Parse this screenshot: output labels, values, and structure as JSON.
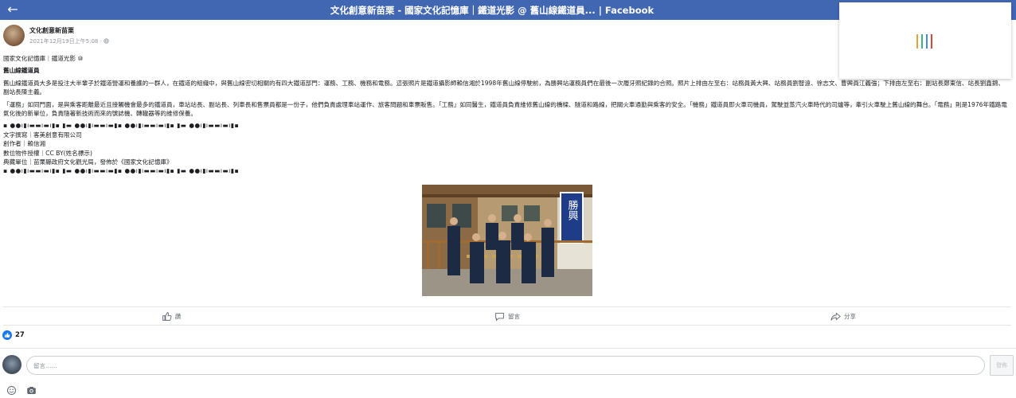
{
  "header": {
    "back_icon": "arrow-left-icon",
    "title": "文化創意新苗栗 - 國家文化記憶庫｜鐵道光影 @ 舊山線鐵道員... | Facebook"
  },
  "loading_colors": [
    "#e9a23b",
    "#3fb27f",
    "#4285f4",
    "#db4437"
  ],
  "post": {
    "page_name": "文化創意新苗栗",
    "time": "2021年12月19日上午5:08 · ",
    "globe_icon": "globe-icon",
    "paragraphs": [
      "國家文化記憶庫｜鐵道光影 ⑩",
      "舊山線鐵道員",
      "舊山線鐵道員大多是投注大半輩子於鐵道營運和養護的一群人，在鐵道的組織中，與舊山線密切相關的有四大鐵道部門：運務、工務、機務和電務。這張照片是鐵道攝影師賴信湘於1998年舊山線停駛前，為勝興站運務員們在最後一次履牙照紀錄的合照。照片上排由左至右：站務員黃大興、站務員劉智遠、徐志文、曹興員江義強；下排由左至右：副站長鄭東信、站長劉鑫錦、副站長陳主義。",
      "「運務」如同門面，是與乘客距離最近且接觸機會最多的鐵道員，車站站長、副站長、列車長和售票員都是一份子，他們負責處理車站運作、旅客問題和車票販售。「工務」如同醫生，鐵道員負責維修舊山線的橋樑、隧道和路線，把關火車通勤與乘客的安全。「機務」鐵道員即火車司機員，駕駛並蒸汽火車時代的司爐等，牽引火車駛上舊山線的舞台。「電務」則是1976年鐵路電氣化後的新單位，負責隨著新技術而來的號誌機、轉轍器等的維修保養。",
      "▪ ●●ı▮ı▬▬ı▬ı▮▪ ▮▬ ●●ı▮ı▬▬ı▬▮▪ ●●ı▮ı▬▬ı▬ı▮▪ ▮▬ ●●ı▮ı▬▬ı▬ı▮▪",
      "文字撰寫｜客美創意有限公司",
      "創作者｜賴信湘",
      "數位物件授權｜CC BY(姓名標示)",
      "典藏單位｜苗栗縣政府文化觀光局，發佈於《國家文化記憶庫》",
      "▪ ●●ı▮ı▬▬ı▬ı▮▪ ▮▬ ●●ı▮ı▬▬ı▬▮▪ ●●ı▮ı▬▬ı▬ı▮▪ ▮▬ ●●ı▮ı▬▬ı▬ı▮▪"
    ],
    "photo": {
      "sign_text": "勝興",
      "image_description": "車站前七位鐵道員合照"
    }
  },
  "actions": {
    "like_label": "讚",
    "comment_label": "留言",
    "share_label": "分享"
  },
  "reactions": {
    "icon": "like-thumb-icon",
    "count": "27"
  },
  "composer": {
    "placeholder": "留言……",
    "post_button": "發佈",
    "emoji_icon": "emoji-icon",
    "camera_icon": "camera-icon"
  }
}
